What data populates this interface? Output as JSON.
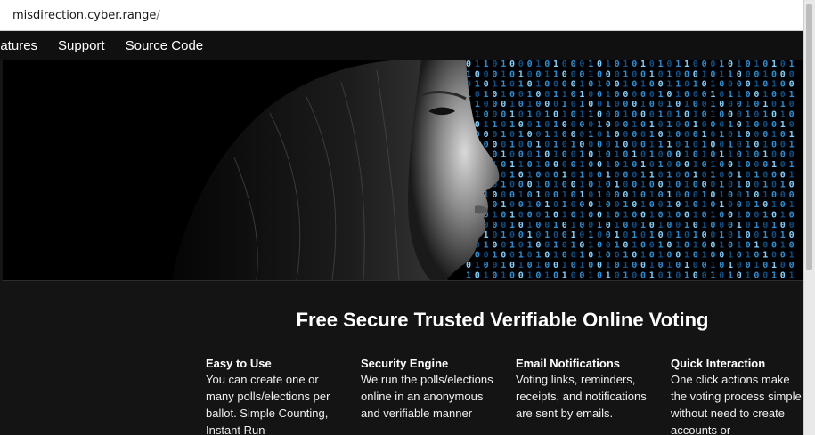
{
  "browser": {
    "url_host": "misdirection.cyber.range",
    "url_path": "/"
  },
  "nav": {
    "items": [
      "eatures",
      "Support",
      "Source Code"
    ]
  },
  "hero": {
    "binary_rows": [
      "01101000101000101010101011000101010101",
      "10001010011000100010010100010110001000",
      "01011010100001010010100110101000010100",
      "10101001001101001000001010001011001001",
      "01000101000101001000100101001000101010",
      "11000101010101100010001010101000101010",
      "00110100101000010001010100100010100010",
      "10001010011000101000010100010101000101",
      "01000100101010000100011101010010101001",
      "10101000101001010101010001010110101000",
      "00010110100001001010101000101001000101",
      "11010101000101001000110100101001010001",
      "01101000101001010100100101000101001010",
      "10100010100101010001010100010100101000",
      "00101001010100010010100101010100010101",
      "10010100010101001010010100101001001010",
      "01000101001010010100101001010001010100",
      "10101001010010100101010010100101001010",
      "00100101001010100101001010100101010010",
      "10010010101001010010101001010010101001",
      "01001010100101001010010101001010010100",
      "10101001010100101010010101001010100101"
    ],
    "colors": {
      "digit_bright": "#7fd0ff",
      "digit_mid": "#2a8fd6",
      "digit_dim": "#0d4f86"
    }
  },
  "main": {
    "headline": "Free Secure Trusted Verifiable Online Voting",
    "features": [
      {
        "title": "Easy to Use",
        "text": "You can create one or many polls/elections per ballot. Simple Counting, Instant Run-"
      },
      {
        "title": "Security Engine",
        "text": "We run the polls/elections online in an anonymous and verifiable manner"
      },
      {
        "title": "Email Notifications",
        "text": "Voting links, reminders, receipts, and notifications are sent by emails."
      },
      {
        "title": "Quick Interaction",
        "text": "One click actions make the voting process simple without need to create accounts or"
      }
    ]
  }
}
